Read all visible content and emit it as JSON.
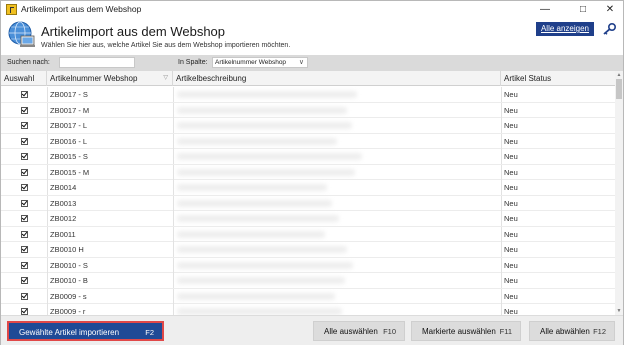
{
  "window": {
    "title": "Artikelimport aus dem Webshop"
  },
  "header": {
    "title": "Artikelimport aus dem Webshop",
    "subtitle": "Wählen Sie hier aus, welche Artikel Sie aus dem Webshop importieren möchten.",
    "show_all_label": "Alle anzeigen"
  },
  "filter": {
    "search_label": "Suchen nach:",
    "search_value": "",
    "column_label": "In Spalte:",
    "column_selected": "Artikelnummer Webshop"
  },
  "grid": {
    "columns": [
      "Auswahl",
      "Artikelnummer Webshop",
      "Artikelbeschreibung",
      "Artikel Status"
    ],
    "rows": [
      {
        "checked": true,
        "sku": "ZB0017 - S",
        "status": "Neu"
      },
      {
        "checked": true,
        "sku": "ZB0017 - M",
        "status": "Neu"
      },
      {
        "checked": true,
        "sku": "ZB0017 - L",
        "status": "Neu"
      },
      {
        "checked": true,
        "sku": "ZB0016 - L",
        "status": "Neu"
      },
      {
        "checked": true,
        "sku": "ZB0015 - S",
        "status": "Neu"
      },
      {
        "checked": true,
        "sku": "ZB0015 - M",
        "status": "Neu"
      },
      {
        "checked": true,
        "sku": "ZB0014",
        "status": "Neu"
      },
      {
        "checked": true,
        "sku": "ZB0013",
        "status": "Neu"
      },
      {
        "checked": true,
        "sku": "ZB0012",
        "status": "Neu"
      },
      {
        "checked": true,
        "sku": "ZB0011",
        "status": "Neu"
      },
      {
        "checked": true,
        "sku": "ZB0010 H",
        "status": "Neu"
      },
      {
        "checked": true,
        "sku": "ZB0010 - S",
        "status": "Neu"
      },
      {
        "checked": true,
        "sku": "ZB0010 - B",
        "status": "Neu"
      },
      {
        "checked": true,
        "sku": "ZB0009 - s",
        "status": "Neu"
      },
      {
        "checked": true,
        "sku": "ZB0009 - r",
        "status": "Neu"
      }
    ]
  },
  "footer": {
    "import_label": "Gewählte Artikel importieren",
    "import_key": "F2",
    "select_all_label": "Alle auswählen",
    "select_all_key": "F10",
    "select_marked_label": "Markierte auswählen",
    "select_marked_key": "F11",
    "deselect_all_label": "Alle abwählen",
    "deselect_all_key": "F12"
  },
  "icons": {
    "app": "app-icon",
    "globe": "globe-computer-icon",
    "search": "search-key-icon",
    "minimize": "minimize-icon",
    "maximize": "maximize-icon",
    "close": "close-icon"
  },
  "colors": {
    "accent": "#1f3f8a",
    "primary_button": "#1f4a96",
    "highlight_border": "#e04848"
  }
}
